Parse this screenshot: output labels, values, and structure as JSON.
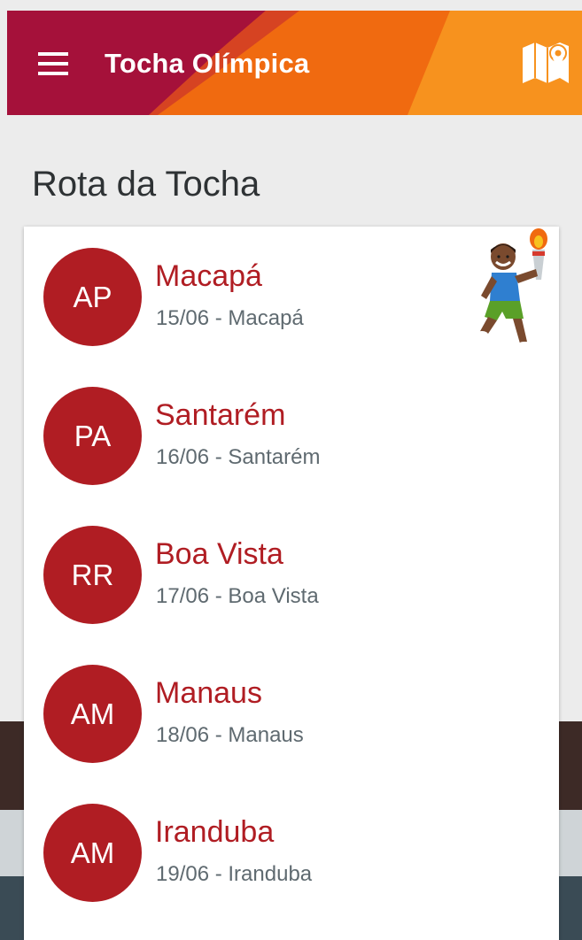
{
  "app_bar": {
    "title": "Tocha Olímpica",
    "menu_icon": "hamburger-menu-icon",
    "map_icon": "map-pin-icon"
  },
  "page": {
    "title": "Rota da Tocha"
  },
  "colors": {
    "accent_red": "#b01d23",
    "header_crimson": "#a5113a",
    "header_orange": "#f06a10",
    "header_amber": "#f7921e"
  },
  "routes": [
    {
      "initials": "AP",
      "city": "Macapá",
      "detail": "15/06 - Macapá"
    },
    {
      "initials": "PA",
      "city": "Santarém",
      "detail": "16/06 - Santarém"
    },
    {
      "initials": "RR",
      "city": "Boa Vista",
      "detail": "17/06 - Boa Vista"
    },
    {
      "initials": "AM",
      "city": "Manaus",
      "detail": "18/06 - Manaus"
    },
    {
      "initials": "AM",
      "city": "Iranduba",
      "detail": "19/06 - Iranduba"
    }
  ]
}
